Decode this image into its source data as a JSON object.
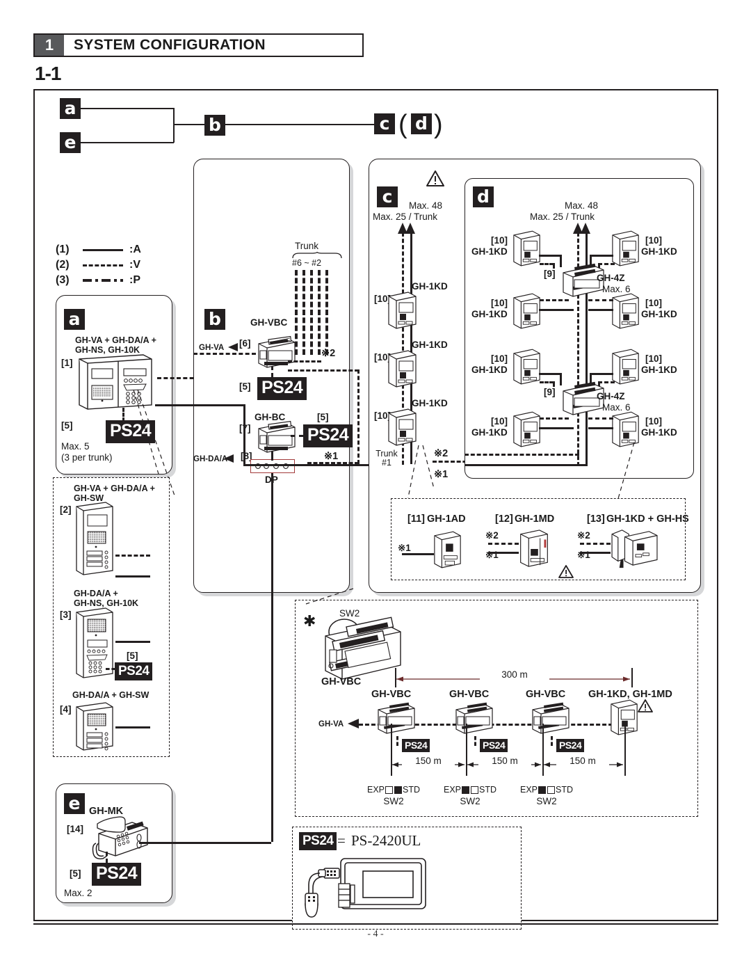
{
  "header": {
    "number": "1",
    "title": "SYSTEM CONFIGURATION",
    "section": "1-1"
  },
  "page": {
    "footer": "- 4 -"
  },
  "top_flow": {
    "a": "a",
    "b": "b",
    "c": "c",
    "d": "d",
    "e": "e",
    "paren_open": "(",
    "paren_close": ")"
  },
  "legend": {
    "rows": [
      {
        "key": "(1)",
        "style": "solid",
        "label": ":A"
      },
      {
        "key": "(2)",
        "style": "dash",
        "label": ":V"
      },
      {
        "key": "(3)",
        "style": "dashdot",
        "label": ":P"
      }
    ]
  },
  "panel_a": {
    "tag": "a",
    "title_line1": "GH-VA + GH-DA/A +",
    "title_line2": "GH-NS, GH-10K",
    "ref": "[1]",
    "ps24_ref": "[5]",
    "ps24": "PS24",
    "note_line1": "Max. 5",
    "note_line2": "(3 per trunk)"
  },
  "panel_a_sub": {
    "items": [
      {
        "ref": "[2]",
        "title_line1": "GH-VA + GH-DA/A +",
        "title_line2": "GH-SW"
      },
      {
        "ref": "[3]",
        "title_line1": "GH-DA/A +",
        "title_line2": "GH-NS, GH-10K",
        "ps24_ref": "[5]",
        "ps24": "PS24"
      },
      {
        "ref": "[4]",
        "title_line1": "GH-DA/A + GH-SW",
        "title_line2": ""
      }
    ]
  },
  "panel_b": {
    "tag": "b",
    "trunk_label": "Trunk",
    "trunk_range": "#6 ~ #2",
    "vbc_label": "GH-VBC",
    "vbc_ref": "[6]",
    "vbc_ps24_ref": "[5]",
    "vbc_ps24": "PS24",
    "gh_va_label": "GH-VA",
    "note2": "※2",
    "bc_label": "GH-BC",
    "bc_ref": "[7]",
    "bc_ps24_ref": "[5]",
    "bc_ps24": "PS24",
    "dp_ref": "[8]",
    "dp_label": "DP",
    "gh_da_label": "GH-DA/A",
    "note1": "※1"
  },
  "panel_c": {
    "tag": "c",
    "max_total": "Max. 48",
    "max_trunk": "Max. 25 / Trunk",
    "stations": [
      {
        "ref": "[10]",
        "label": "GH-1KD"
      },
      {
        "ref": "[10]",
        "label": "GH-1KD"
      },
      {
        "ref": "[10]",
        "label": "GH-1KD"
      }
    ],
    "trunk_line1": "Trunk",
    "trunk_line2": "#1",
    "note1": "※1",
    "note2": "※2"
  },
  "panel_d": {
    "tag": "d",
    "max_total": "Max. 48",
    "max_trunk": "Max. 25 / Trunk",
    "hub_ref": "[9]",
    "hub_label": "GH-4Z",
    "hub_max": "Max. 6",
    "stations": [
      {
        "ref": "[10]",
        "label": "GH-1KD"
      },
      {
        "ref": "[10]",
        "label": "GH-1KD"
      },
      {
        "ref": "[10]",
        "label": "GH-1KD"
      },
      {
        "ref": "[10]",
        "label": "GH-1KD"
      },
      {
        "ref": "[10]",
        "label": "GH-1KD"
      },
      {
        "ref": "[10]",
        "label": "GH-1KD"
      },
      {
        "ref": "[10]",
        "label": "GH-1KD"
      },
      {
        "ref": "[10]",
        "label": "GH-1KD"
      }
    ]
  },
  "panel_options": {
    "items": [
      {
        "ref": "[11]",
        "label": "GH-1AD",
        "note1": "※1",
        "note2": ""
      },
      {
        "ref": "[12]",
        "label": "GH-1MD",
        "note1": "※1",
        "note2": "※2"
      },
      {
        "ref": "[13]",
        "label": "GH-1KD + GH-HS",
        "note1": "※1",
        "note2": "※2"
      }
    ]
  },
  "distance_diagram": {
    "asterisk": "✱",
    "sw2_callout": "SW2",
    "source_label": "GH-VBC",
    "total_distance": "300 m",
    "gh_va_label": "GH-VA",
    "nodes": [
      {
        "label": "GH-VBC",
        "ps24": "PS24",
        "seg": "150 m",
        "sw_exp": "EXP",
        "sw_std": "STD",
        "sw2": "SW2",
        "sw_state": "std"
      },
      {
        "label": "GH-VBC",
        "ps24": "PS24",
        "seg": "150 m",
        "sw_exp": "EXP",
        "sw_std": "STD",
        "sw2": "SW2",
        "sw_state": "exp"
      },
      {
        "label": "GH-VBC",
        "ps24": "PS24",
        "seg": "150 m",
        "sw_exp": "EXP",
        "sw_std": "STD",
        "sw2": "SW2",
        "sw_state": "exp"
      }
    ],
    "end_label": "GH-1KD, GH-1MD"
  },
  "ps24_legend": {
    "badge": "PS24",
    "equals": "=",
    "model": "PS-2420UL"
  },
  "panel_e": {
    "tag": "e",
    "label": "GH-MK",
    "ref": "[14]",
    "ps24_ref": "[5]",
    "ps24": "PS24",
    "note": "Max. 2"
  },
  "colors": {
    "ink": "#231f20",
    "shadow": "#d6d7d9",
    "header_num_bg": "#58595b"
  }
}
